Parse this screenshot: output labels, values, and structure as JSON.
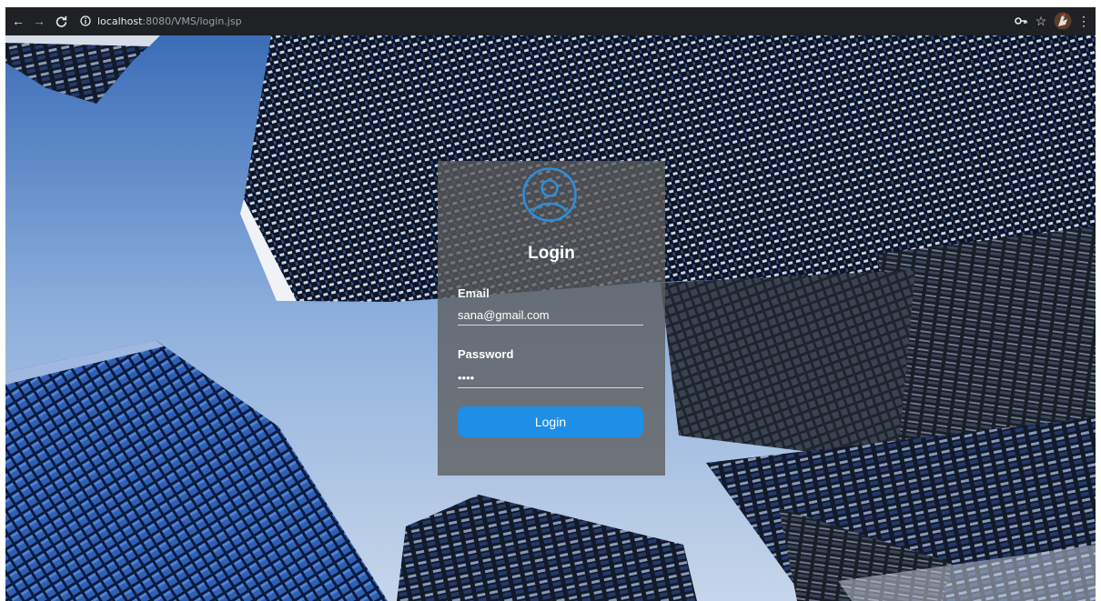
{
  "browser": {
    "url_host": "localhost",
    "url_rest": ":8080/VMS/login.jsp",
    "icons": {
      "back": "back-arrow-icon",
      "forward": "forward-arrow-icon",
      "reload": "reload-icon",
      "info": "info-icon",
      "key": "key-icon",
      "star": "bookmark-star-icon",
      "avatar": "profile-avatar-icon",
      "menu": "kebab-menu-icon"
    }
  },
  "login": {
    "title": "Login",
    "email_label": "Email",
    "email_value": "sana@gmail.com",
    "password_label": "Password",
    "password_value": "1234",
    "button_label": "Login",
    "icon": "user-circle-icon"
  },
  "colors": {
    "accent": "#1f8ee6",
    "icon_blue": "#2a8fdc",
    "card": "#5c5c5c"
  }
}
